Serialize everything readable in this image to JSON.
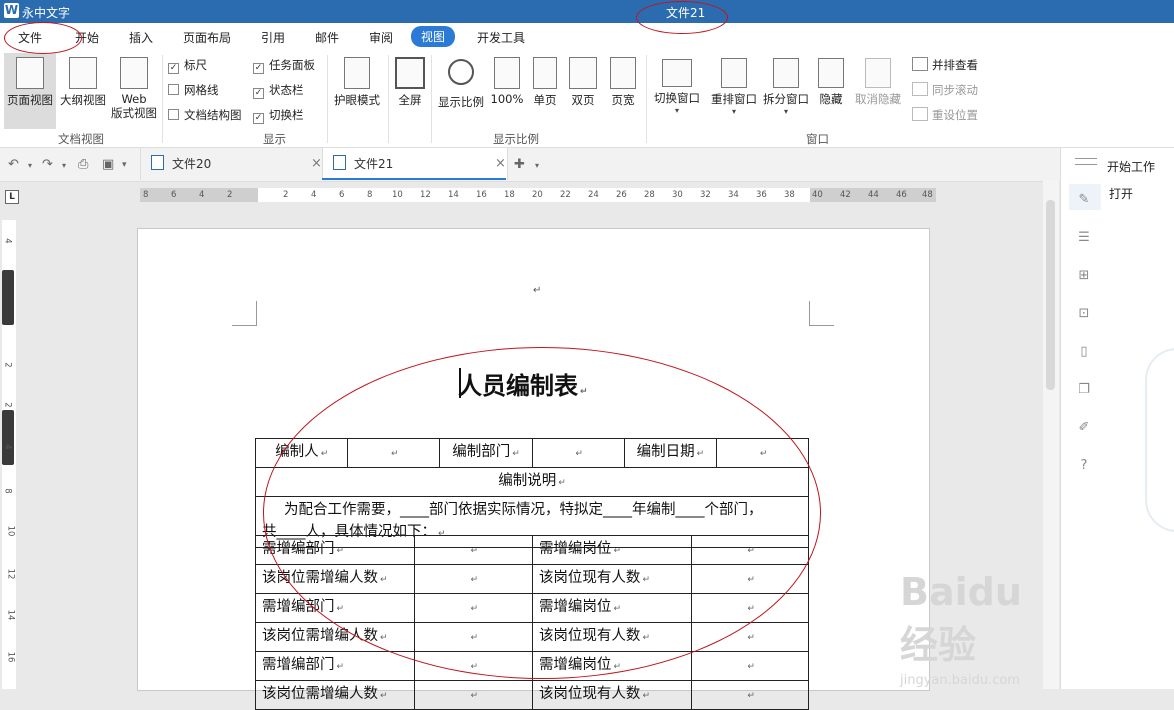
{
  "app": {
    "logo_letter": "W",
    "name": "永中文字",
    "doc_title": "文件21"
  },
  "menu": {
    "tabs": [
      "文件",
      "开始",
      "插入",
      "页面布局",
      "引用",
      "邮件",
      "审阅",
      "视图",
      "开发工具"
    ],
    "active": "视图"
  },
  "ribbon": {
    "doc_view": {
      "group_label": "文档视图",
      "page_view": "页面视图",
      "outline_view": "大纲视图",
      "web_view_1": "Web",
      "web_view_2": "版式视图"
    },
    "display": {
      "group_label": "显示",
      "ruler": "标尺",
      "gridlines": "网格线",
      "doc_structure": "文档结构图",
      "task_pane": "任务面板",
      "status_bar": "状态栏",
      "switch_bar": "切换栏"
    },
    "eye_mode": "护眼模式",
    "fullscreen": "全屏",
    "zoom": {
      "group_label": "显示比例",
      "zoom_ratio": "显示比例",
      "percent_100": "100%",
      "single_page": "单页",
      "double_page": "双页",
      "page_width": "页宽"
    },
    "window": {
      "group_label": "窗口",
      "switch_window": "切换窗口",
      "arrange": "重排窗口",
      "split": "拆分窗口",
      "hide": "隐藏",
      "unhide": "取消隐藏",
      "side_by_side": "并排查看",
      "sync_scroll": "同步滚动",
      "reset_position": "重设位置"
    }
  },
  "doc_tabs": [
    {
      "label": "文件20"
    },
    {
      "label": "文件21",
      "active": true
    }
  ],
  "right_panel": {
    "title": "开始工作",
    "open": "打开"
  },
  "ruler": {
    "h_labels": [
      "8",
      "6",
      "4",
      "2",
      "2",
      "4",
      "6",
      "8",
      "10",
      "12",
      "14",
      "16",
      "18",
      "20",
      "22",
      "24",
      "26",
      "28",
      "30",
      "32",
      "34",
      "36",
      "38",
      "40",
      "42",
      "44",
      "46",
      "48"
    ],
    "v_labels": [
      "4",
      "2",
      "2",
      "4",
      "8",
      "10",
      "12",
      "14",
      "16"
    ]
  },
  "document": {
    "heading": "人员编制表",
    "table": {
      "row1": [
        "编制人",
        "",
        "编制部门",
        "",
        "编制日期",
        ""
      ],
      "desc_title": "编制说明",
      "desc_line1": "为配合工作需要，____部门依据实际情况，特拟定____年编制____个部门，",
      "desc_line2": "共____人，具体情况如下：",
      "rows": [
        [
          "需增编部门",
          "",
          "需增编岗位",
          ""
        ],
        [
          "该岗位需增编人数",
          "",
          "该岗位现有人数",
          ""
        ],
        [
          "需增编部门",
          "",
          "需增编岗位",
          ""
        ],
        [
          "该岗位需增编人数",
          "",
          "该岗位现有人数",
          ""
        ],
        [
          "需增编部门",
          "",
          "需增编岗位",
          ""
        ],
        [
          "该岗位需增编人数",
          "",
          "该岗位现有人数",
          ""
        ]
      ]
    }
  },
  "watermark": {
    "brand": "Baidu经验",
    "url": "jingyan.baidu.com"
  },
  "colors": {
    "title_bar": "#2b6cb0",
    "accent": "#2b7bd6",
    "annotation": "#c0141c"
  }
}
